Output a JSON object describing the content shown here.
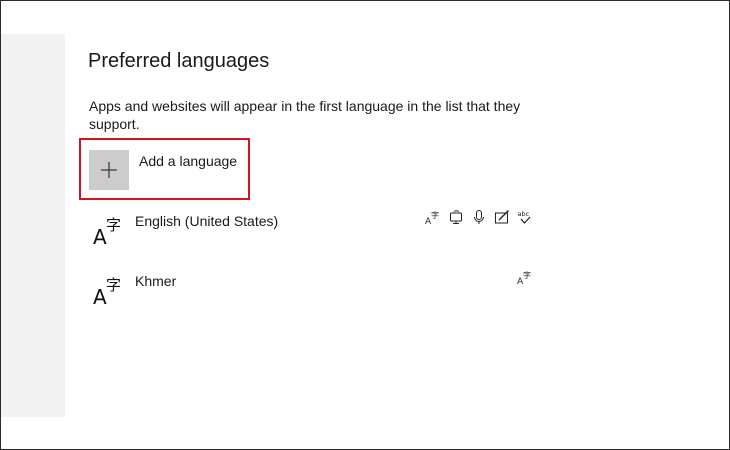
{
  "section": {
    "title": "Preferred languages",
    "description": "Apps and websites will appear in the first language in the list that they support."
  },
  "add_language": {
    "label": "Add a language",
    "icon": "plus-icon"
  },
  "languages": [
    {
      "name": "English (United States)",
      "icon": "language-glyph-icon",
      "features": [
        "display-language-icon",
        "text-to-speech-icon",
        "speech-recognition-icon",
        "handwriting-icon",
        "spell-check-icon"
      ]
    },
    {
      "name": "Khmer",
      "icon": "language-glyph-icon",
      "features": [
        "display-language-icon"
      ]
    }
  ],
  "colors": {
    "highlight": "#d4141f",
    "tile": "#cccccc",
    "pane": "#f2f2f2"
  }
}
